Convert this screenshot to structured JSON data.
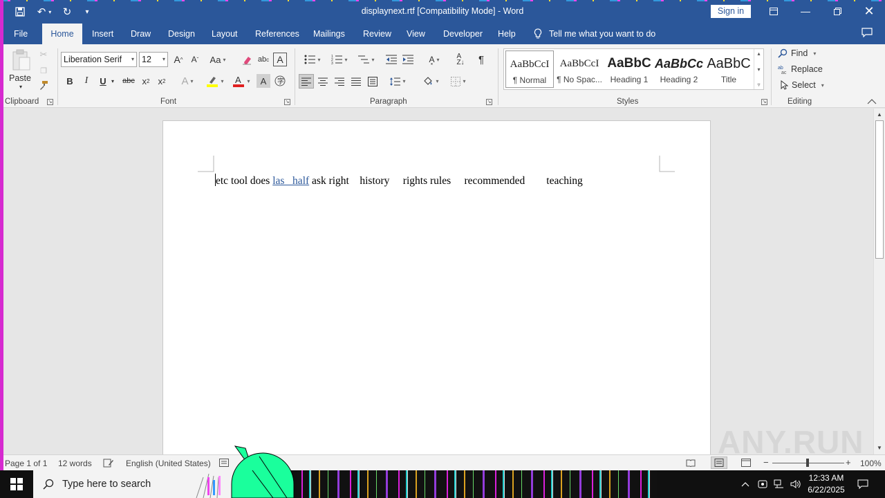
{
  "title_bar": {
    "document_title": "displaynext.rtf [Compatibility Mode]  -  Word",
    "sign_in_label": "Sign in",
    "quick_access": [
      "save-icon",
      "undo-icon",
      "redo-icon",
      "customize-icon"
    ]
  },
  "tabs": [
    "File",
    "Home",
    "Insert",
    "Draw",
    "Design",
    "Layout",
    "References",
    "Mailings",
    "Review",
    "View",
    "Developer",
    "Help"
  ],
  "active_tab": "Home",
  "tell_me": "Tell me what you want to do",
  "ribbon": {
    "clipboard": {
      "label": "Clipboard",
      "paste_label": "Paste"
    },
    "font": {
      "label": "Font",
      "font_name": "Liberation Serif",
      "font_size": "12",
      "case_label": "Aa",
      "bold": "B",
      "italic": "I",
      "underline": "U",
      "strike": "abc"
    },
    "paragraph": {
      "label": "Paragraph"
    },
    "styles": {
      "label": "Styles",
      "items": [
        {
          "preview": "AaBbCcI",
          "name": "¶ Normal"
        },
        {
          "preview": "AaBbCcI",
          "name": "¶ No Spac..."
        },
        {
          "preview": "AaBbC",
          "name": "Heading 1"
        },
        {
          "preview": "AaBbCc",
          "name": "Heading 2"
        },
        {
          "preview": "AaBbC",
          "name": "Title"
        }
      ]
    },
    "editing": {
      "label": "Editing",
      "find": "Find",
      "replace": "Replace",
      "select": "Select"
    }
  },
  "document": {
    "seg1": "etc tool does ",
    "seg_link": "las   half",
    "seg2": " ask right    history     rights rules     recommended        teaching"
  },
  "status_bar": {
    "page": "Page 1 of 1",
    "words": "12 words",
    "language": "English (United States)",
    "zoom": "100%"
  },
  "taskbar": {
    "search_placeholder": "Type here to search",
    "time": "12:33 AM",
    "date": "6/22/2025"
  },
  "watermark": "ANY.RUN",
  "colors": {
    "accent": "#2b579a",
    "ribbon_bg": "#f3f3f3",
    "page_bg": "#ffffff"
  }
}
